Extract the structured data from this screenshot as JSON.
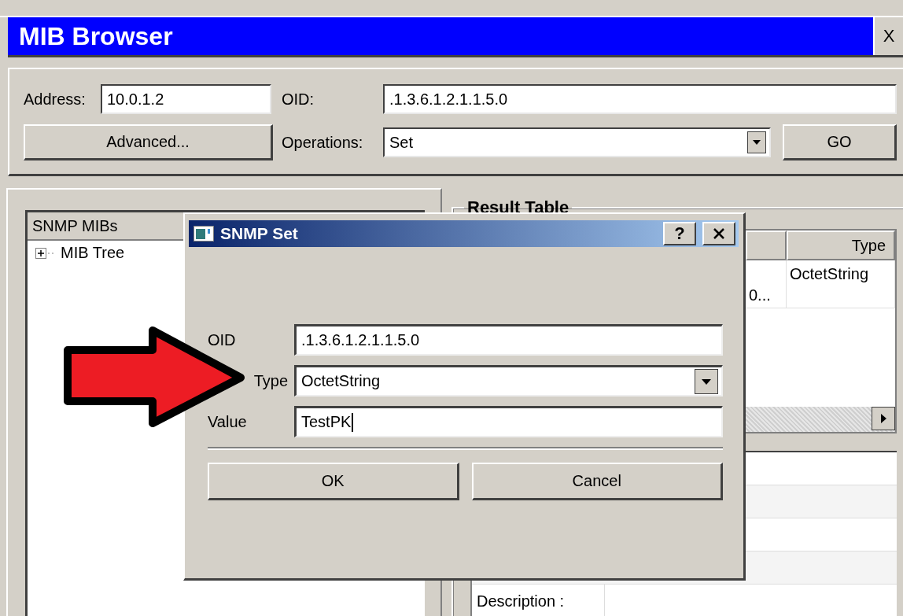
{
  "window": {
    "title": "MIB Browser",
    "close_label": "X"
  },
  "toolbar": {
    "address_label": "Address:",
    "address": "10.0.1.2",
    "oid_label": "OID:",
    "oid": ".1.3.6.1.2.1.1.5.0",
    "advanced_button": "Advanced...",
    "operations_label": "Operations:",
    "operation": "Set",
    "go_button": "GO"
  },
  "mib_panel": {
    "header": "SNMP MIBs",
    "tree": [
      {
        "label": "MIB Tree",
        "expanded": false
      }
    ]
  },
  "result_table": {
    "title": "Result Table",
    "columns": [
      {
        "label": "Type"
      }
    ],
    "rows": [
      {
        "column_2": "0...",
        "type": "OctetString"
      }
    ]
  },
  "details": {
    "rows": [
      {
        "label": "Description :"
      }
    ]
  },
  "dialog": {
    "title": "SNMP Set",
    "help_label": "?",
    "fields": [
      {
        "kind": "text",
        "label": "OID",
        "value": ".1.3.6.1.2.1.1.5.0"
      },
      {
        "kind": "dropdown",
        "label": "Type",
        "value": "OctetString"
      },
      {
        "kind": "text",
        "label": "Value",
        "value": "TestPK",
        "cursor": true
      }
    ],
    "buttons": [
      "OK",
      "Cancel"
    ]
  }
}
